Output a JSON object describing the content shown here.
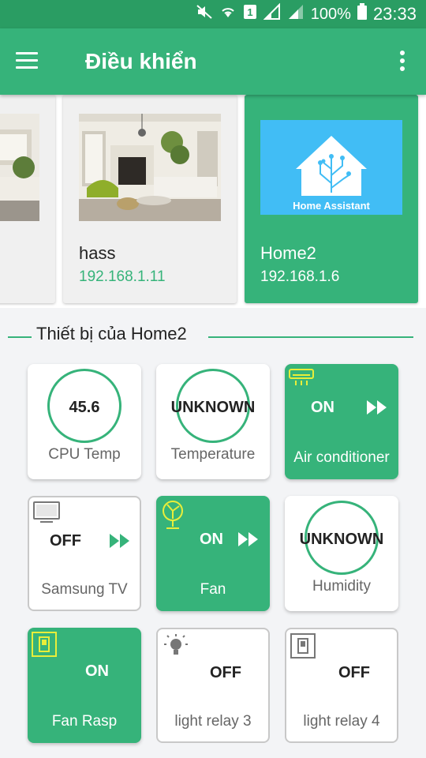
{
  "status_bar": {
    "battery": "100%",
    "time": "23:33",
    "sim": "1"
  },
  "toolbar": {
    "title": "Điều khiển"
  },
  "servers": [
    {
      "name": "",
      "ip": ""
    },
    {
      "name": "hass",
      "ip": "192.168.1.11"
    },
    {
      "name": "Home2",
      "ip": "192.168.1.6",
      "logo_text": "Home Assistant"
    }
  ],
  "section": {
    "title": "Thiết bị của Home2"
  },
  "devices": [
    {
      "label": "CPU Temp",
      "type": "sensor",
      "value": "45.6"
    },
    {
      "label": "Temperature",
      "type": "sensor",
      "value": "UNKNOWN"
    },
    {
      "label": "Air conditioner",
      "type": "switch",
      "state": "ON",
      "icon": "air-conditioner-icon"
    },
    {
      "label": "Samsung TV",
      "type": "switch",
      "state": "OFF",
      "icon": "tv-icon"
    },
    {
      "label": "Fan",
      "type": "switch",
      "state": "ON",
      "icon": "fan-icon"
    },
    {
      "label": "Humidity",
      "type": "sensor",
      "value": "UNKNOWN"
    },
    {
      "label": "Fan Rasp",
      "type": "switch",
      "state": "ON",
      "icon": "wall-switch-icon"
    },
    {
      "label": "light relay 3",
      "type": "switch",
      "state": "OFF",
      "icon": "bulb-icon"
    },
    {
      "label": "light relay 4",
      "type": "switch",
      "state": "OFF",
      "icon": "wall-switch-icon"
    }
  ],
  "colors": {
    "primary": "#36b37a",
    "primary_dark": "#2a9d63",
    "tile_bg": "#ffffff",
    "page_bg": "#f3f4f6"
  }
}
